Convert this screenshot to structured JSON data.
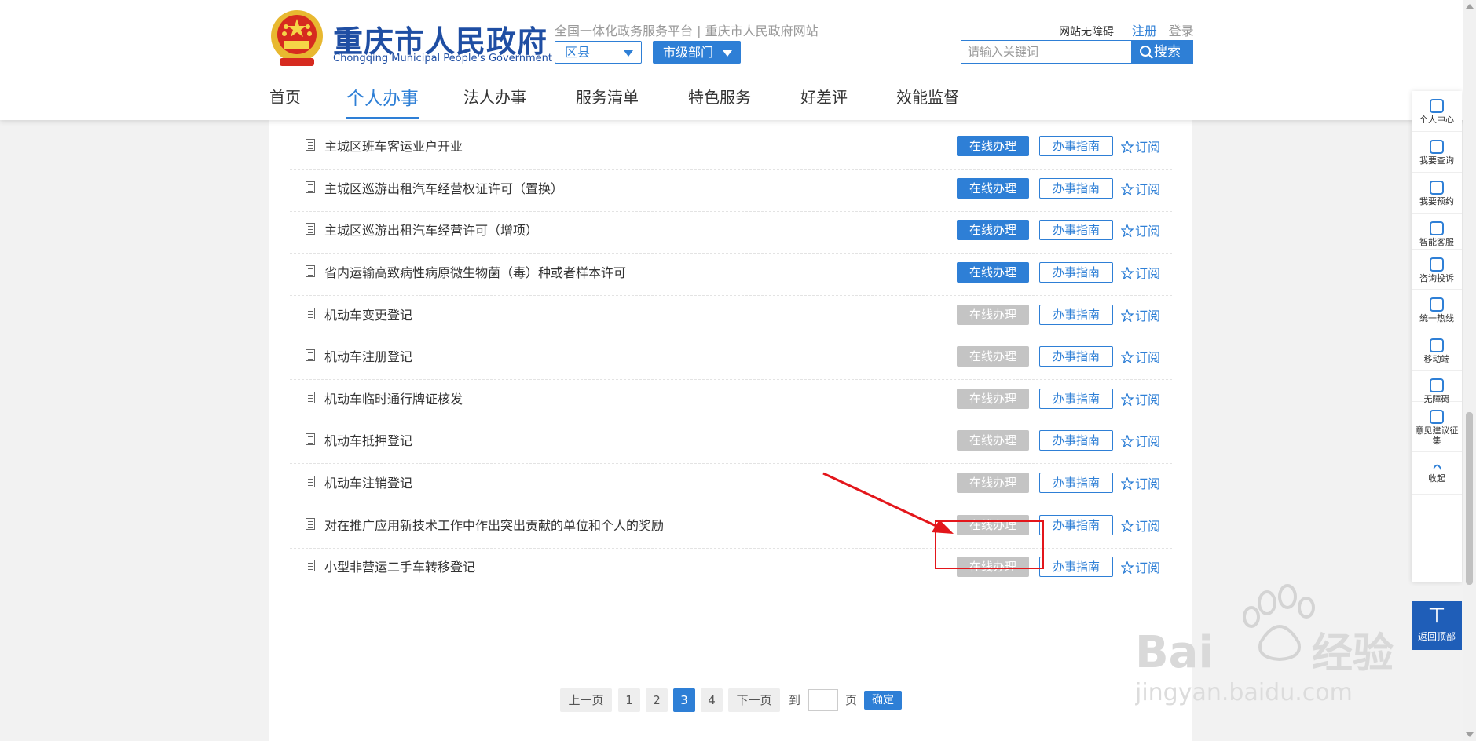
{
  "header": {
    "site_title": "重庆市人民政府",
    "site_subtitle": "Chongqing Municipal People's Government",
    "platform_text": "全国一体化政务服务平台 | 重庆市人民政府网站",
    "district_select": "区县",
    "dept_select": "市级部门",
    "accessibility_link": "网站无障碍",
    "register_link": "注册",
    "login_link": "登录",
    "search_placeholder": "请输入关键词",
    "search_button": "搜索",
    "nav": [
      "首页",
      "个人办事",
      "法人办事",
      "服务清单",
      "特色服务",
      "好差评",
      "效能监督"
    ],
    "active_nav": "个人办事"
  },
  "colors": {
    "brand_blue": "#2e7fd6",
    "title_blue": "#1f4ea3",
    "disabled_gray": "#c4c4c4",
    "annotation_red": "#e3161b"
  },
  "services": [
    {
      "name": "主城区班车客运业户开业",
      "online_label": "在线办理",
      "online_enabled": true,
      "guide_label": "办事指南",
      "subscribe_label": "订阅"
    },
    {
      "name": "主城区巡游出租汽车经营权证许可（置换）",
      "online_label": "在线办理",
      "online_enabled": true,
      "guide_label": "办事指南",
      "subscribe_label": "订阅"
    },
    {
      "name": "主城区巡游出租汽车经营许可（增项）",
      "online_label": "在线办理",
      "online_enabled": true,
      "guide_label": "办事指南",
      "subscribe_label": "订阅"
    },
    {
      "name": "省内运输高致病性病原微生物菌（毒）种或者样本许可",
      "online_label": "在线办理",
      "online_enabled": true,
      "guide_label": "办事指南",
      "subscribe_label": "订阅"
    },
    {
      "name": "机动车变更登记",
      "online_label": "在线办理",
      "online_enabled": false,
      "guide_label": "办事指南",
      "subscribe_label": "订阅"
    },
    {
      "name": "机动车注册登记",
      "online_label": "在线办理",
      "online_enabled": false,
      "guide_label": "办事指南",
      "subscribe_label": "订阅"
    },
    {
      "name": "机动车临时通行牌证核发",
      "online_label": "在线办理",
      "online_enabled": false,
      "guide_label": "办事指南",
      "subscribe_label": "订阅"
    },
    {
      "name": "机动车抵押登记",
      "online_label": "在线办理",
      "online_enabled": false,
      "guide_label": "办事指南",
      "subscribe_label": "订阅"
    },
    {
      "name": "机动车注销登记",
      "online_label": "在线办理",
      "online_enabled": false,
      "guide_label": "办事指南",
      "subscribe_label": "订阅"
    },
    {
      "name": "对在推广应用新技术工作中作出突出贡献的单位和个人的奖励",
      "online_label": "在线办理",
      "online_enabled": false,
      "guide_label": "办事指南",
      "subscribe_label": "订阅"
    },
    {
      "name": "小型非营运二手车转移登记",
      "online_label": "在线办理",
      "online_enabled": false,
      "guide_label": "办事指南",
      "subscribe_label": "订阅"
    }
  ],
  "pagination": {
    "prev": "上一页",
    "pages": [
      "1",
      "2",
      "3",
      "4"
    ],
    "current": "3",
    "next": "下一页",
    "goto": "到",
    "page_unit": "页",
    "confirm": "确定"
  },
  "sidebar": {
    "items": [
      "个人中心",
      "我要查询",
      "我要预约",
      "智能客服",
      "咨询投诉",
      "统一热线",
      "移动端",
      "无障碍",
      "意见建议征集",
      "收起"
    ],
    "back_to_top": "返回顶部"
  },
  "icons": {
    "doc": "document-icon",
    "star": "star-outline-icon",
    "search": "search-icon",
    "up": "up-arrow-icon"
  }
}
